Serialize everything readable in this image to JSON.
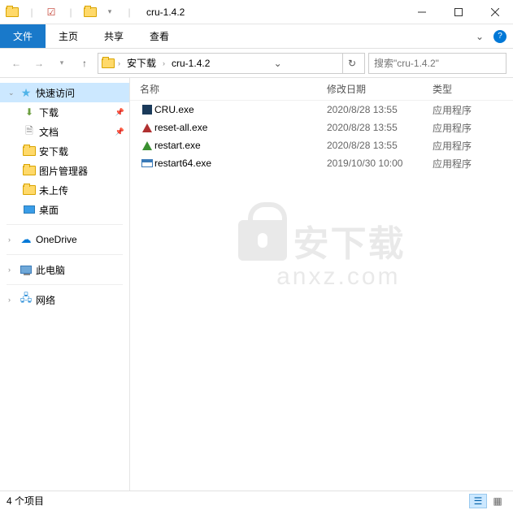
{
  "window": {
    "title": "cru-1.4.2"
  },
  "ribbon": {
    "file": "文件",
    "tabs": [
      "主页",
      "共享",
      "查看"
    ]
  },
  "breadcrumb": {
    "items": [
      "安下载",
      "cru-1.4.2"
    ]
  },
  "search": {
    "placeholder": "搜索\"cru-1.4.2\""
  },
  "sidebar": {
    "quick_access": "快速访问",
    "items": [
      {
        "label": "下载",
        "pinned": true
      },
      {
        "label": "文档",
        "pinned": true
      },
      {
        "label": "安下载",
        "pinned": false
      },
      {
        "label": "图片管理器",
        "pinned": false
      },
      {
        "label": "未上传",
        "pinned": false
      },
      {
        "label": "桌面",
        "pinned": false
      }
    ],
    "onedrive": "OneDrive",
    "this_pc": "此电脑",
    "network": "网络"
  },
  "columns": {
    "name": "名称",
    "date": "修改日期",
    "type": "类型"
  },
  "files": [
    {
      "name": "CRU.exe",
      "date": "2020/8/28 13:55",
      "type": "应用程序",
      "icon": "cru"
    },
    {
      "name": "reset-all.exe",
      "date": "2020/8/28 13:55",
      "type": "应用程序",
      "icon": "tri-red"
    },
    {
      "name": "restart.exe",
      "date": "2020/8/28 13:55",
      "type": "应用程序",
      "icon": "tri-green"
    },
    {
      "name": "restart64.exe",
      "date": "2019/10/30 10:00",
      "type": "应用程序",
      "icon": "exe"
    }
  ],
  "status": {
    "count": "4 个项目"
  },
  "watermark": {
    "main": "安下载",
    "sub": "anxz.com"
  }
}
